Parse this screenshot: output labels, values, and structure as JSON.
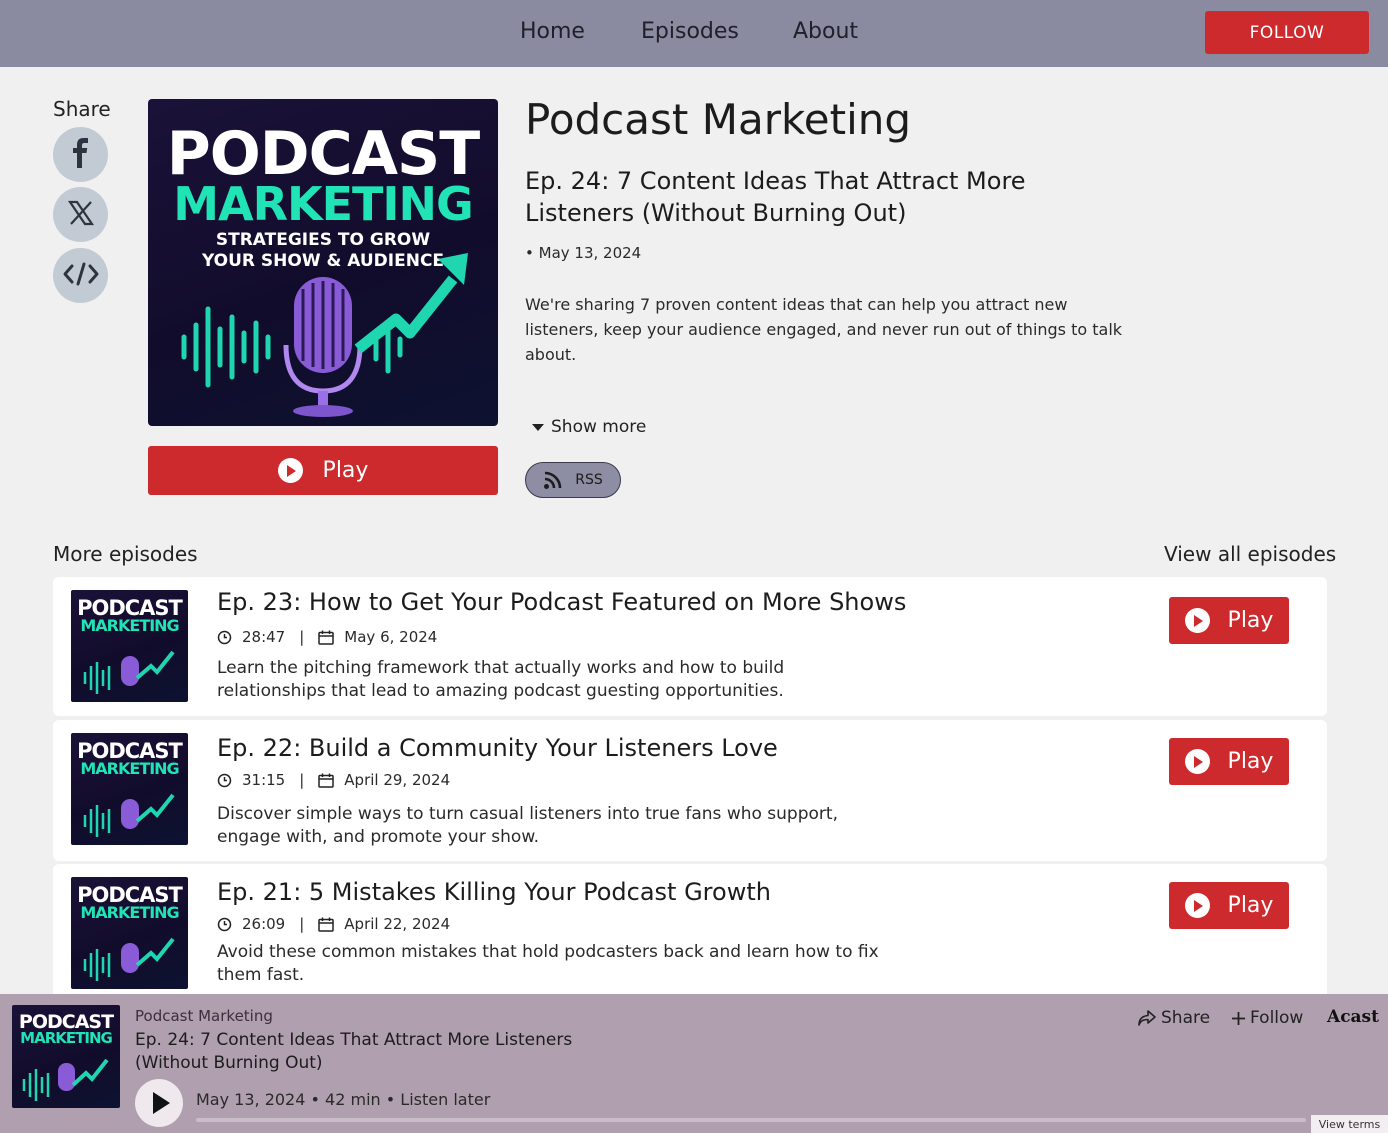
{
  "nav": {
    "links": [
      "Home",
      "Episodes",
      "About"
    ],
    "follow_label": "FOLLOW"
  },
  "share": {
    "label": "Share",
    "icons": [
      "facebook-icon",
      "x-icon",
      "embed-icon"
    ]
  },
  "cover_art": {
    "line1": "PODCAST",
    "line2": "MARKETING",
    "line3": "STRATEGIES TO GROW",
    "line4": "YOUR SHOW & AUDIENCE"
  },
  "episode": {
    "podcast_title": "Podcast Marketing",
    "title": "Ep. 24: 7 Content Ideas That Attract More Listeners (Without Burning Out)",
    "date": "May 13, 2024",
    "description": "We're sharing 7 proven content ideas that can help you attract new listeners, keep your audience engaged, and never run out of things to talk about.",
    "show_more_label": "Show more",
    "rss_label": "RSS",
    "play_label": "Play"
  },
  "more_episodes": {
    "label": "More episodes",
    "view_all_label": "View all episodes",
    "items": [
      {
        "title": "Ep. 23: How to Get Your Podcast Featured on More Shows",
        "duration": "28:47",
        "date": "May 6, 2024",
        "description": "Learn the pitching framework that actually works and how to build relationships that lead to amazing podcast guesting opportunities.",
        "play_label": "Play"
      },
      {
        "title": "Ep. 22: Build a Community Your Listeners Love",
        "duration": "31:15",
        "date": "April 29, 2024",
        "description": "Discover simple ways to turn casual listeners into true fans who support, engage with, and promote your show.",
        "play_label": "Play"
      },
      {
        "title": "Ep. 21: 5 Mistakes Killing Your Podcast Growth",
        "duration": "26:09",
        "date": "April 22, 2024",
        "description": "Avoid these common mistakes that hold podcasters back and learn how to fix them fast.",
        "play_label": "Play"
      }
    ]
  },
  "player": {
    "show": "Podcast Marketing",
    "title": "Ep. 24: 7 Content Ideas That Attract More Listeners (Without Burning Out)",
    "date": "May 13, 2024",
    "length": "42 min",
    "listen_later": "Listen later",
    "share_label": "Share",
    "follow_label": "Follow",
    "brand": "Acast",
    "view_terms": "View terms",
    "progress": 0
  },
  "colors": {
    "nav_bg": "#8a8aa0",
    "accent_red": "#cc2a2d",
    "player_bg": "#b09fae",
    "cover_teal": "#20e3b6"
  }
}
